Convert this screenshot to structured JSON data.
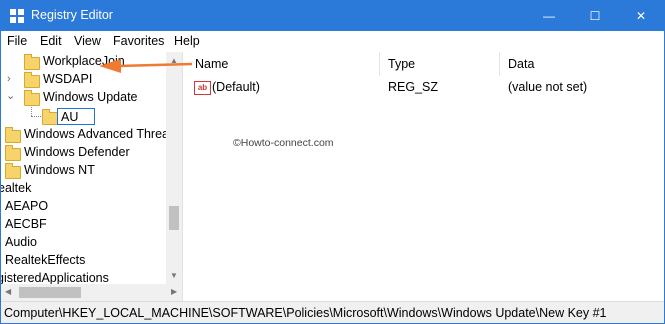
{
  "window": {
    "title": "Registry Editor",
    "minimize_glyph": "—",
    "maximize_glyph": "☐",
    "close_glyph": "✕"
  },
  "menu": [
    "File",
    "Edit",
    "View",
    "Favorites",
    "Help"
  ],
  "tree": {
    "items": [
      {
        "label": "WorkplaceJoin",
        "chevron": ""
      },
      {
        "label": "WSDAPI",
        "chevron": "›"
      },
      {
        "label": "Windows Update",
        "chevron": "⌄"
      },
      {
        "label": "Windows Advanced Threat",
        "chevron": ""
      },
      {
        "label": "Windows Defender",
        "chevron": ""
      },
      {
        "label": "Windows NT",
        "chevron": ""
      },
      {
        "label": "ealtek",
        "chevron": ""
      },
      {
        "label": "AEAPO",
        "chevron": ""
      },
      {
        "label": "AECBF",
        "chevron": ""
      },
      {
        "label": "Audio",
        "chevron": ""
      },
      {
        "label": "RealtekEffects",
        "chevron": ""
      },
      {
        "label": "gisteredApplications",
        "chevron": ""
      }
    ],
    "editing_value": "AU"
  },
  "list": {
    "columns": [
      "Name",
      "Type",
      "Data"
    ],
    "rows": [
      {
        "name": "(Default)",
        "type": "REG_SZ",
        "data": "(value not set)",
        "icon": "ab"
      }
    ]
  },
  "watermark": "©Howto-connect.com",
  "status": "Computer\\HKEY_LOCAL_MACHINE\\SOFTWARE\\Policies\\Microsoft\\Windows\\Windows Update\\New Key #1",
  "colors": {
    "titlebar": "#2b79d8",
    "arrow": "#f07a30",
    "folder": "#f6d36b"
  }
}
